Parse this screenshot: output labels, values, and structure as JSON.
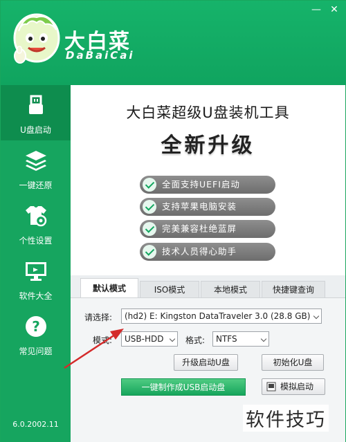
{
  "window": {
    "brand": "大白菜",
    "brand_en": "DaBaiCai",
    "min_glyph": "—",
    "close_glyph": "✕"
  },
  "sidebar": {
    "items": [
      {
        "label": "U盘启动",
        "icon": "usb-drive-icon",
        "active": true
      },
      {
        "label": "一键还原",
        "icon": "layers-icon",
        "active": false
      },
      {
        "label": "个性设置",
        "icon": "shirt-gear-icon",
        "active": false
      },
      {
        "label": "软件大全",
        "icon": "monitor-icon",
        "active": false
      },
      {
        "label": "常见问题",
        "icon": "question-icon",
        "active": false
      }
    ],
    "version": "6.0.2002.11"
  },
  "main": {
    "headline": "大白菜超级U盘装机工具",
    "subhead": "全新升级",
    "features": [
      "全面支持UEFI启动",
      "支持苹果电脑安装",
      "完美兼容杜绝蓝屏",
      "技术人员得心助手"
    ]
  },
  "tabs": [
    {
      "label": "默认模式",
      "active": true
    },
    {
      "label": "ISO模式",
      "active": false
    },
    {
      "label": "本地模式",
      "active": false
    },
    {
      "label": "快捷键查询",
      "active": false
    }
  ],
  "form": {
    "select_label": "请选择:",
    "device_value": "(hd2) E: Kingston DataTraveler 3.0 (28.8 GB)",
    "mode_label": "模式:",
    "mode_value": "USB-HDD",
    "format_label": "格式:",
    "format_value": "NTFS",
    "upgrade_button": "升级启动U盘",
    "init_button": "初始化U盘",
    "make_button": "一键制作成USB启动盘",
    "simulate_button": "模拟启动"
  },
  "watermark": "软件技巧",
  "colors": {
    "brand_green": "#16a55f",
    "active_nav": "#0e8d4e",
    "arrow_red": "#d42b2b"
  }
}
